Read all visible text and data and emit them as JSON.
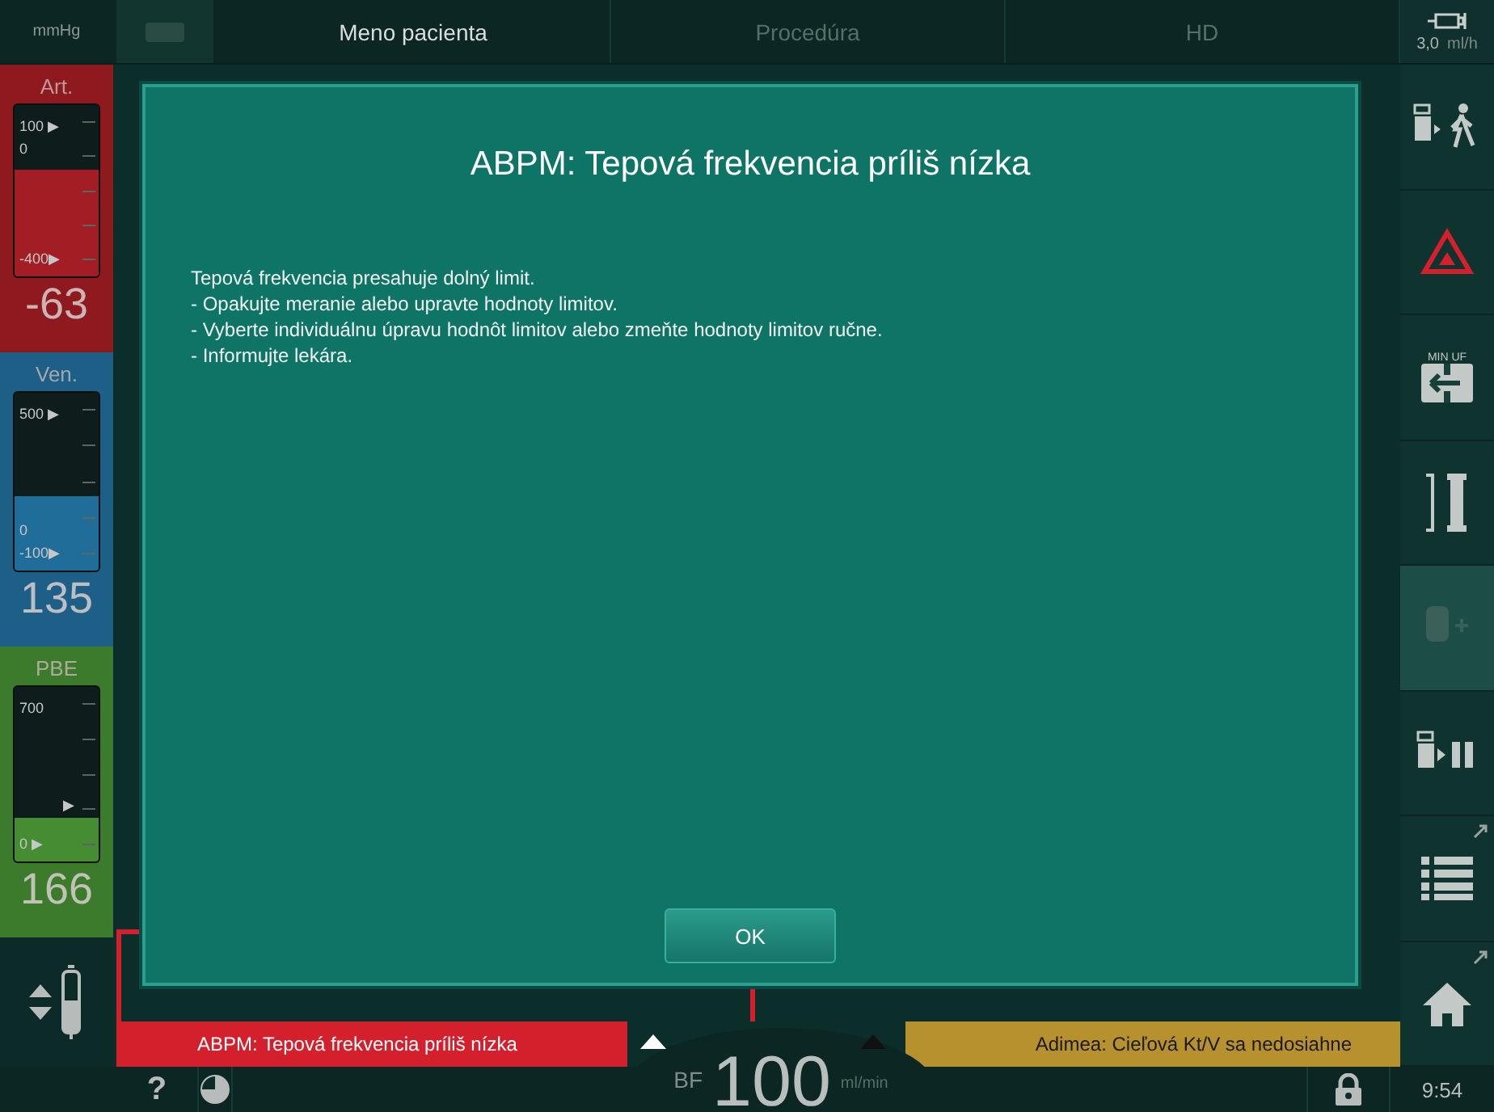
{
  "top_bar": {
    "unit": "mmHg",
    "tabs": [
      {
        "label": "Meno pacienta",
        "selected": true
      },
      {
        "label": "Procedúra",
        "selected": false
      },
      {
        "label": "HD",
        "selected": false
      }
    ],
    "syringe_rate": "3,0",
    "syringe_unit": "ml/h"
  },
  "gauges": [
    {
      "kind": "art",
      "label": "Art.",
      "scale": [
        "100 ▶",
        "0",
        "-400▶"
      ],
      "level": 0.62,
      "value": "-63",
      "color": "#8e1a1f"
    },
    {
      "kind": "ven",
      "label": "Ven.",
      "scale": [
        "500 ▶",
        "0",
        "-100▶"
      ],
      "level": 0.42,
      "value": "135",
      "color": "#1d5f86"
    },
    {
      "kind": "pbe",
      "label": "PBE",
      "scale": [
        "700",
        "▶",
        "0  ▶"
      ],
      "level": 0.25,
      "value": "166",
      "color": "#3c7a2c"
    }
  ],
  "dialog": {
    "title": "ABPM: Tepová frekvencia príliš nízka",
    "lines": [
      "Tepová frekvencia presahuje dolný limit.",
      "- Opakujte meranie alebo upravte hodnoty limitov.",
      "- Vyberte individuálnu úpravu hodnôt limitov alebo zmeňte hodnoty limitov ručne.",
      "- Informujte lekára."
    ],
    "button": "OK"
  },
  "alarms": [
    {
      "text": "ABPM: Tepová frekvencia príliš nízka",
      "color": "#d4202c"
    },
    {
      "text": "Adimea: Cieľová Kt/V sa nedosiahne",
      "color": "#b8912f"
    }
  ],
  "side_buttons": [
    {
      "kind": "walk",
      "disabled": false
    },
    {
      "kind": "alarm",
      "disabled": false
    },
    {
      "kind": "minuf",
      "label": "MIN UF",
      "disabled": false
    },
    {
      "kind": "dialyzer",
      "disabled": false
    },
    {
      "kind": "bag",
      "disabled": true
    },
    {
      "kind": "pause",
      "disabled": false
    },
    {
      "kind": "list",
      "disabled": false
    },
    {
      "kind": "home",
      "disabled": false
    }
  ],
  "status_bar": {
    "help": "?",
    "bf_label": "BF",
    "bf_value": "100",
    "bf_unit": "ml/min",
    "time": "9:54"
  }
}
